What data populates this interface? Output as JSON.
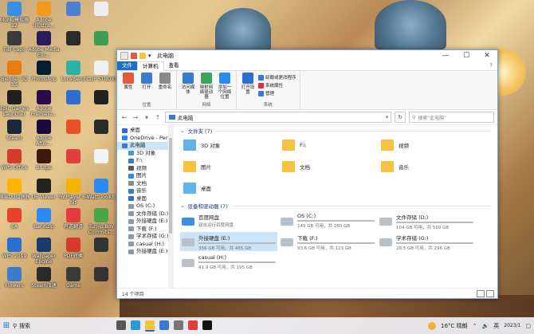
{
  "desktop_icons": [
    {
      "label": "MuMu模拟器12",
      "color": "#3a8ee6"
    },
    {
      "label": "Adobe Illustra...",
      "color": "#f29a1b"
    },
    {
      "label": "",
      "color": "#4a7fd1"
    },
    {
      "label": "",
      "color": "#eeeeee"
    },
    {
      "label": "Full Capo",
      "color": "#3b3b3b"
    },
    {
      "label": "Adobe Media Enc...",
      "color": "#2a1a5e"
    },
    {
      "label": "",
      "color": "#2b2b2b"
    },
    {
      "label": "",
      "color": "#3c9d4e"
    },
    {
      "label": "Blender 3D 3.5",
      "color": "#e87d0d"
    },
    {
      "label": "Photoshop",
      "color": "#001e36"
    },
    {
      "label": "LocalSend",
      "color": "#2ab3a6"
    },
    {
      "label": "CLIP STUDIO",
      "color": "#f1f1f1"
    },
    {
      "label": "Epic Games Launcher",
      "color": "#1f1f1f"
    },
    {
      "label": "Adobe Premiere...",
      "color": "#2a0a4e"
    },
    {
      "label": "",
      "color": "#2a6fd1"
    },
    {
      "label": "",
      "color": "#222222"
    },
    {
      "label": "Steam",
      "color": "#1b2838"
    },
    {
      "label": "Adobe After...",
      "color": "#1a0a3e"
    },
    {
      "label": "",
      "color": "#e84f2b"
    },
    {
      "label": "",
      "color": "#2a2a2a"
    },
    {
      "label": "WPS Office",
      "color": "#d63a2c"
    },
    {
      "label": "Bridge",
      "color": "#3a1a0e"
    },
    {
      "label": "",
      "color": "#e23e3e"
    },
    {
      "label": "",
      "color": "#f2f2f2"
    },
    {
      "label": "网易UU加速器",
      "color": "#ffb400"
    },
    {
      "label": "UE Viewer",
      "color": "#222222"
    },
    {
      "label": "PotPlayer 64 bit",
      "color": "#f2b400"
    },
    {
      "label": "Watt Toolkit",
      "color": "#2a8cf2"
    },
    {
      "label": "EA",
      "color": "#e8412c"
    },
    {
      "label": "Bandizip",
      "color": "#2a8cf2"
    },
    {
      "label": "有道翻译",
      "color": "#e83a3a"
    },
    {
      "label": "Turnip Boy Commits...",
      "color": "#4aa54a"
    },
    {
      "label": "WPS 2019",
      "color": "#2a6fd1"
    },
    {
      "label": "Wallpaper Engine",
      "color": "#1a3a6e"
    },
    {
      "label": "PDF转换",
      "color": "#d63a2c"
    },
    {
      "label": "",
      "color": "#333333"
    },
    {
      "label": "Flowers",
      "color": "#3a7ad1"
    },
    {
      "label": "Steam加速",
      "color": "#2a2a2a"
    },
    {
      "label": "Game",
      "color": "#3a3a3a"
    },
    {
      "label": "",
      "color": "#333333"
    }
  ],
  "window": {
    "title": "此电脑",
    "tabs": [
      "文件",
      "计算机",
      "查看"
    ],
    "ribbon": {
      "groups": [
        {
          "label": "位置",
          "buttons": [
            {
              "label": "属性",
              "color": "#e25a3a"
            },
            {
              "label": "打开",
              "color": "#3a7ad1"
            },
            {
              "label": "重命名",
              "color": "#8a8a8a"
            }
          ]
        },
        {
          "label": "网络",
          "buttons": [
            {
              "label": "访问媒体",
              "color": "#3a7ad1"
            },
            {
              "label": "映射网络驱动器",
              "color": "#3aa55a"
            },
            {
              "label": "添加一个网络位置",
              "color": "#2a8cf2"
            }
          ]
        },
        {
          "label": "系统",
          "buttons": [
            {
              "label": "打开设置",
              "color": "#2a6fd1"
            }
          ],
          "small": [
            {
              "label": "卸载或更改程序",
              "color": "#3a7ad1"
            },
            {
              "label": "系统属性",
              "color": "#d1352c"
            },
            {
              "label": "管理",
              "color": "#3a7ad1"
            }
          ]
        }
      ]
    },
    "address": "此电脑",
    "search_placeholder": "搜索\"此电脑\"",
    "nav_items": [
      {
        "label": "桌面",
        "color": "#2a6fd1",
        "sel": false
      },
      {
        "label": "OneDrive - Perso",
        "color": "#2a8cf2",
        "sel": false
      },
      {
        "label": "此电脑",
        "color": "#3a7ad1",
        "sel": true
      },
      {
        "label": "3D 对象",
        "color": "#3a9ae8",
        "sel": false
      },
      {
        "label": "F:\\",
        "color": "#3a7ad1",
        "sel": false
      },
      {
        "label": "视频",
        "color": "#5a5a5a",
        "sel": false
      },
      {
        "label": "图片",
        "color": "#3a8ad1",
        "sel": false
      },
      {
        "label": "文档",
        "color": "#8a8a8a",
        "sel": false
      },
      {
        "label": "音乐",
        "color": "#3a7ad1",
        "sel": false
      },
      {
        "label": "桌面",
        "color": "#2a6fd1",
        "sel": false
      },
      {
        "label": "OS (C:)",
        "color": "#8a9aa5",
        "sel": false
      },
      {
        "label": "文件存储 (D:)",
        "color": "#8a9aa5",
        "sel": false
      },
      {
        "label": "外接硬盘 (E:)",
        "color": "#8a9aa5",
        "sel": false
      },
      {
        "label": "下载 (F:)",
        "color": "#8a9aa5",
        "sel": false
      },
      {
        "label": "学术存储 (G:)",
        "color": "#8a9aa5",
        "sel": false
      },
      {
        "label": "casual (H:)",
        "color": "#8a9aa5",
        "sel": false
      },
      {
        "label": "外接硬盘 (E:)",
        "color": "#8a9aa5",
        "sel": false
      }
    ],
    "folders_header": "文件夹 (7)",
    "folders": [
      {
        "label": "3D 对象",
        "color": "#62b3e8"
      },
      {
        "label": "F:\\",
        "color": "#f5c242"
      },
      {
        "label": "视频",
        "color": "#f5c242"
      },
      {
        "label": "图片",
        "color": "#f5c242"
      },
      {
        "label": "文档",
        "color": "#f5c242"
      },
      {
        "label": "音乐",
        "color": "#f5c242"
      },
      {
        "label": "桌面",
        "color": "#62b3e8"
      }
    ],
    "drives_header": "设备和驱动器 (7)",
    "drives": [
      {
        "name": "百度网盘",
        "free": "双击运行百度网盘",
        "fill": 0,
        "netdisk": true,
        "sel": false
      },
      {
        "name": "OS (C:)",
        "free": "149 GB 可用，共 260 GB",
        "fill": 0.43,
        "sel": false
      },
      {
        "name": "文件存储 (D:)",
        "free": "104 GB 可用，共 510 GB",
        "fill": 0.8,
        "sel": false
      },
      {
        "name": "外接硬盘 (E:)",
        "free": "356 GB 可用，共 465 GB",
        "fill": 0.23,
        "sel": true
      },
      {
        "name": "下载 (F:)",
        "free": "93.6 GB 可用，共 123 GB",
        "fill": 0.24,
        "sel": false
      },
      {
        "name": "学术存储 (G:)",
        "free": "28.5 GB 可用，共 296 GB",
        "fill": 0.9,
        "sel": false
      },
      {
        "name": "casual (H:)",
        "free": "41.9 GB 可用，共 195 GB",
        "fill": 0.79,
        "sel": false
      }
    ],
    "status": "14 个项目"
  },
  "taskbar": {
    "search_label": "搜索",
    "weather": "16°C 晴朗",
    "lang": "英",
    "time": "",
    "date": "2023/1"
  }
}
